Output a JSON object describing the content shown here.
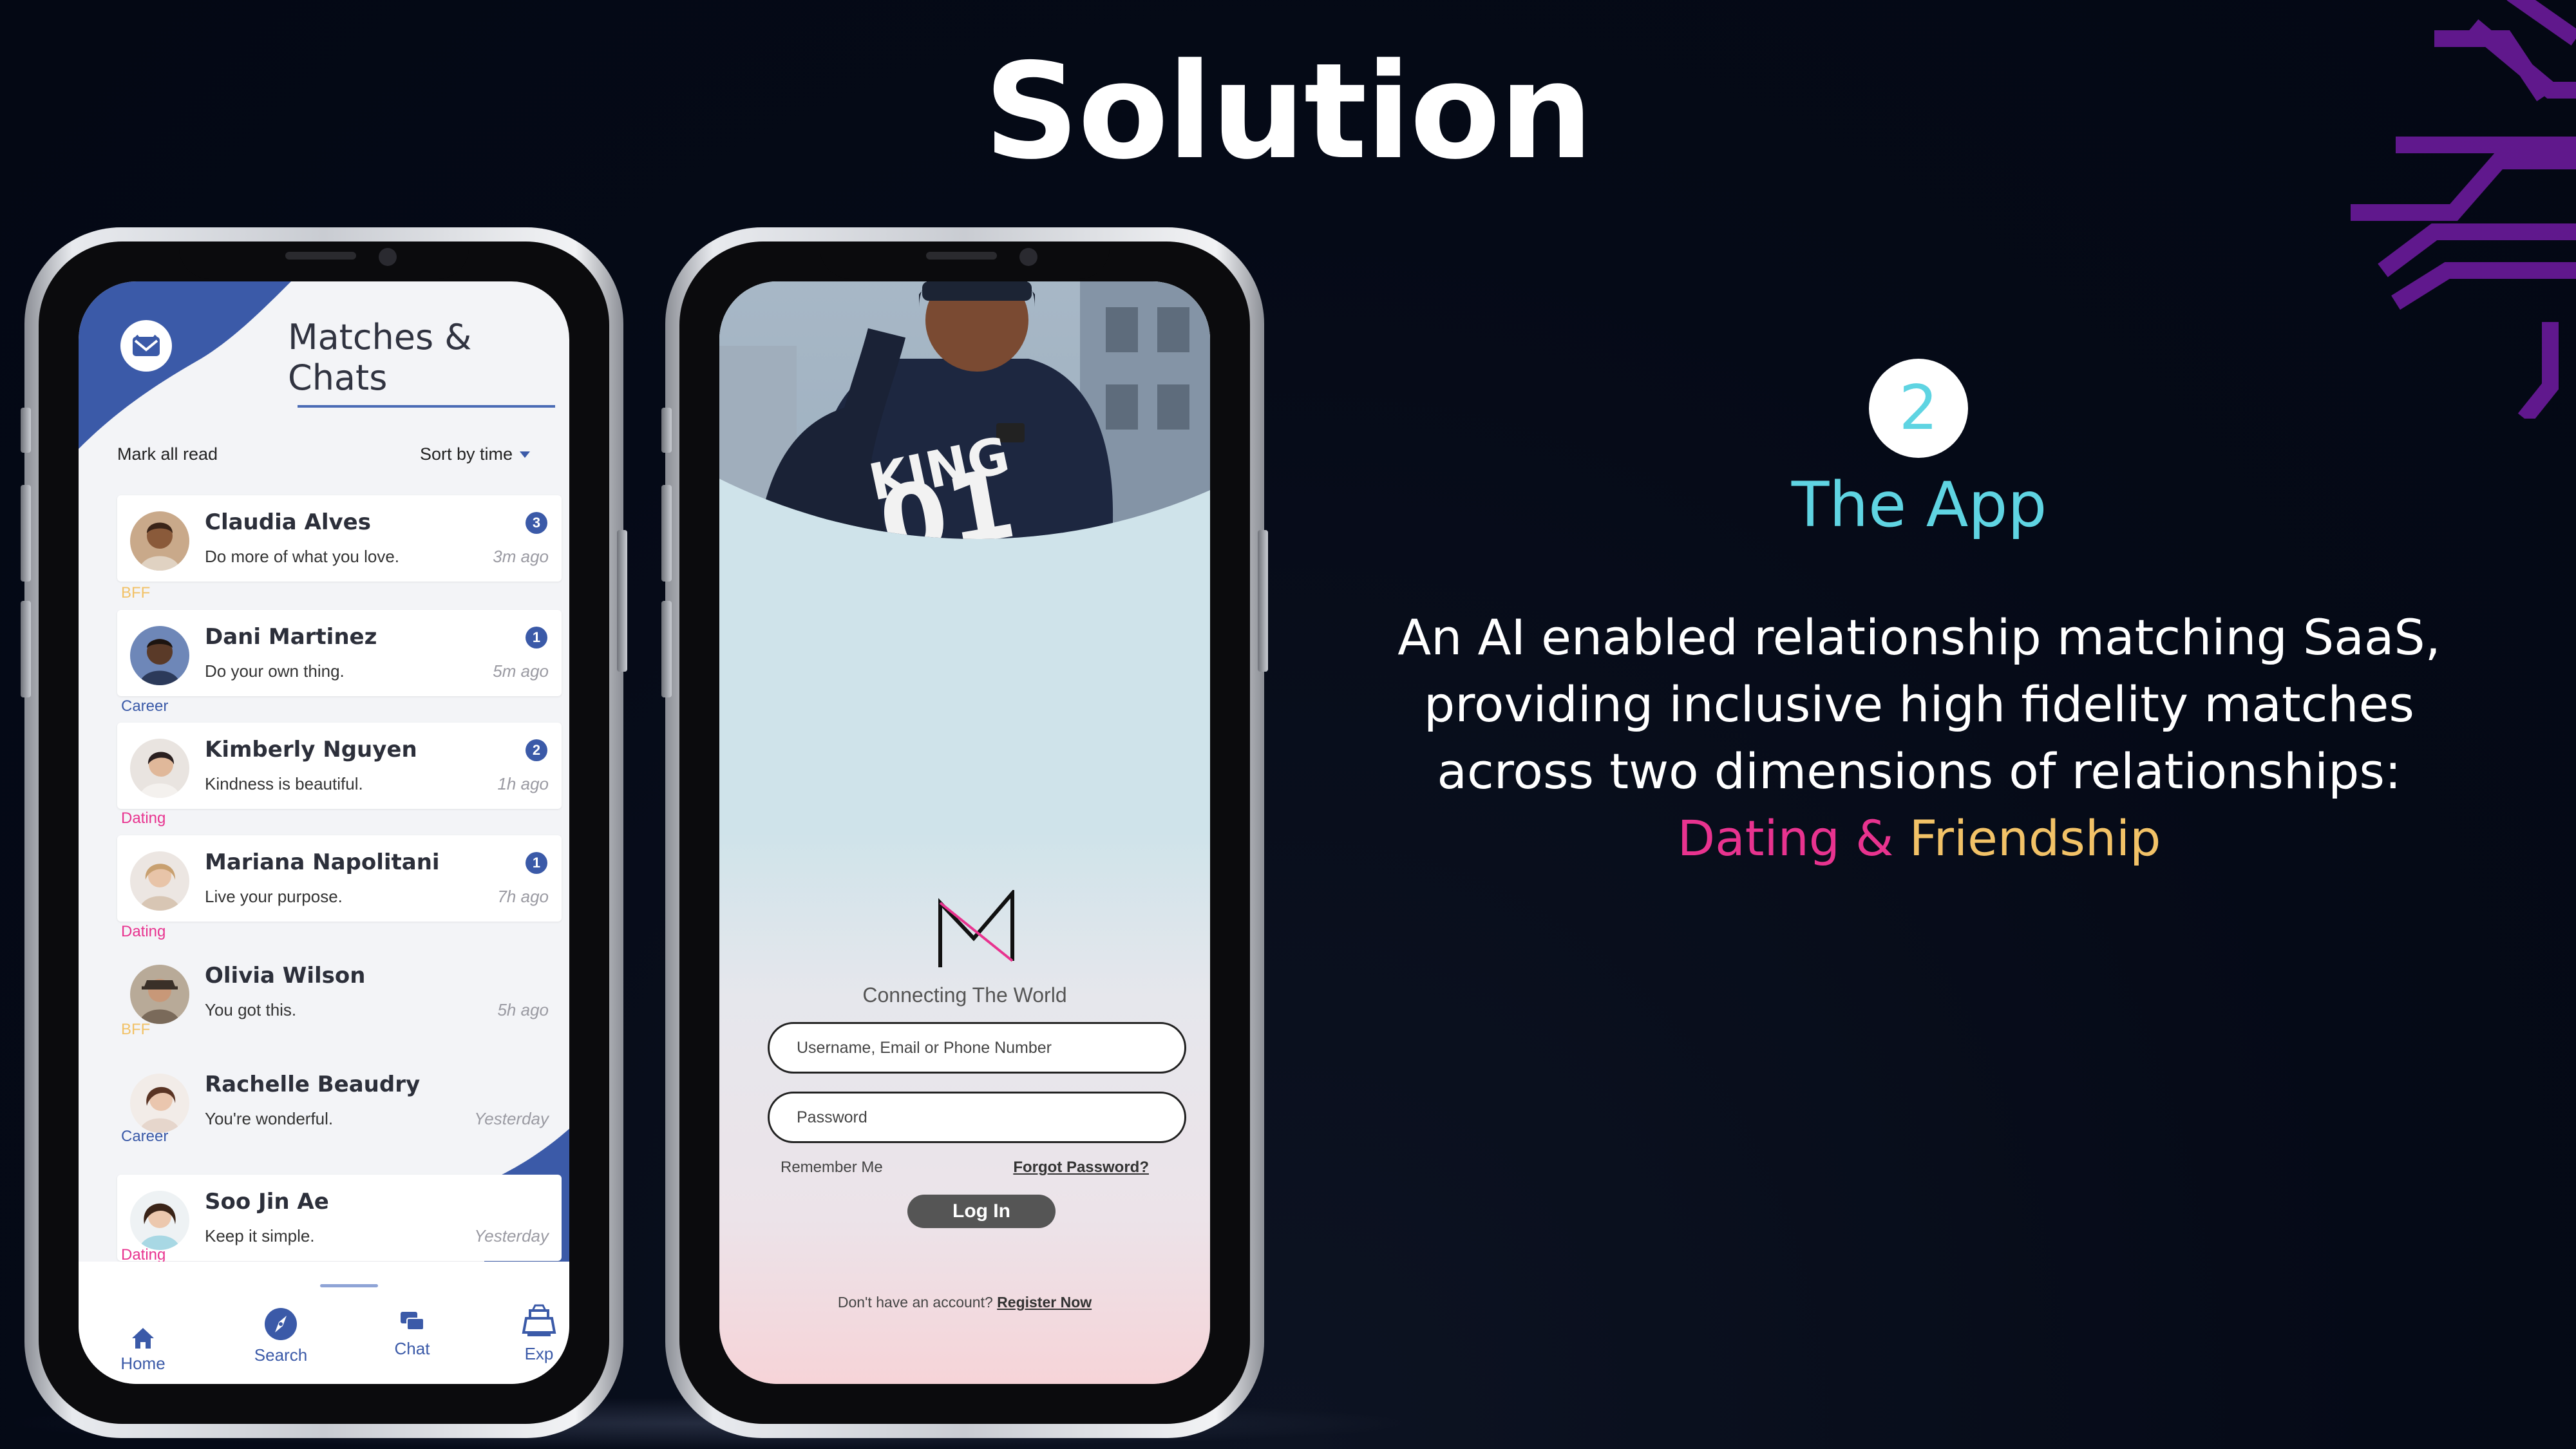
{
  "slide": {
    "title": "Solution",
    "section_number": "2",
    "section_title": "The App",
    "description_lines": [
      "An AI enabled relationship matching SaaS,",
      "providing inclusive high fidelity matches",
      "across two dimensions of relationships:"
    ],
    "highlight": {
      "dating": "Dating",
      "amp": " & ",
      "friendship": "Friendship"
    },
    "colors": {
      "accent_cyan": "#5fd4e2",
      "dating_pink": "#e8338f",
      "friendship_gold": "#f2c267",
      "app_blue": "#3b5aa8"
    }
  },
  "matches_screen": {
    "title": "Matches & Chats",
    "mark_all_read": "Mark all read",
    "sort_label": "Sort by time",
    "chats": [
      {
        "name": "Claudia Alves",
        "message": "Do more of what you love.",
        "time": "3m ago",
        "unread": "3",
        "tag": "BFF",
        "tag_color": "#f2c267"
      },
      {
        "name": "Dani Martinez",
        "message": "Do your own thing.",
        "time": "5m ago",
        "unread": "1",
        "tag": "Career",
        "tag_color": "#3b5aa8"
      },
      {
        "name": "Kimberly Nguyen",
        "message": "Kindness is beautiful.",
        "time": "1h ago",
        "unread": "2",
        "tag": "Dating",
        "tag_color": "#e8338f"
      },
      {
        "name": "Mariana Napolitani",
        "message": "Live your purpose.",
        "time": "7h ago",
        "unread": "1",
        "tag": "Dating",
        "tag_color": "#e8338f"
      },
      {
        "name": "Olivia Wilson",
        "message": "You got this.",
        "time": "5h ago",
        "unread": "",
        "tag": "BFF",
        "tag_color": "#f2c267"
      },
      {
        "name": "Rachelle Beaudry",
        "message": "You're wonderful.",
        "time": "Yesterday",
        "unread": "",
        "tag": "Career",
        "tag_color": "#3b5aa8"
      },
      {
        "name": "Soo Jin Ae",
        "message": "Keep it simple.",
        "time": "Yesterday",
        "unread": "",
        "tag": "Dating",
        "tag_color": "#e8338f"
      }
    ],
    "nav": [
      {
        "label": "Home",
        "icon": "home-icon"
      },
      {
        "label": "Search",
        "icon": "compass-icon"
      },
      {
        "label": "Chat",
        "icon": "chat-icon"
      },
      {
        "label": "Exp",
        "icon": "explore-icon"
      }
    ]
  },
  "login_screen": {
    "tagline": "Connecting The World",
    "username_placeholder": "Username, Email or Phone Number",
    "password_placeholder": "Password",
    "remember_me": "Remember Me",
    "forgot_password": "Forgot Password?",
    "login_button": "Log In",
    "no_account": "Don't have an account?",
    "register": "Register Now",
    "shirt_text_top": "KING",
    "shirt_text_number": "01"
  }
}
